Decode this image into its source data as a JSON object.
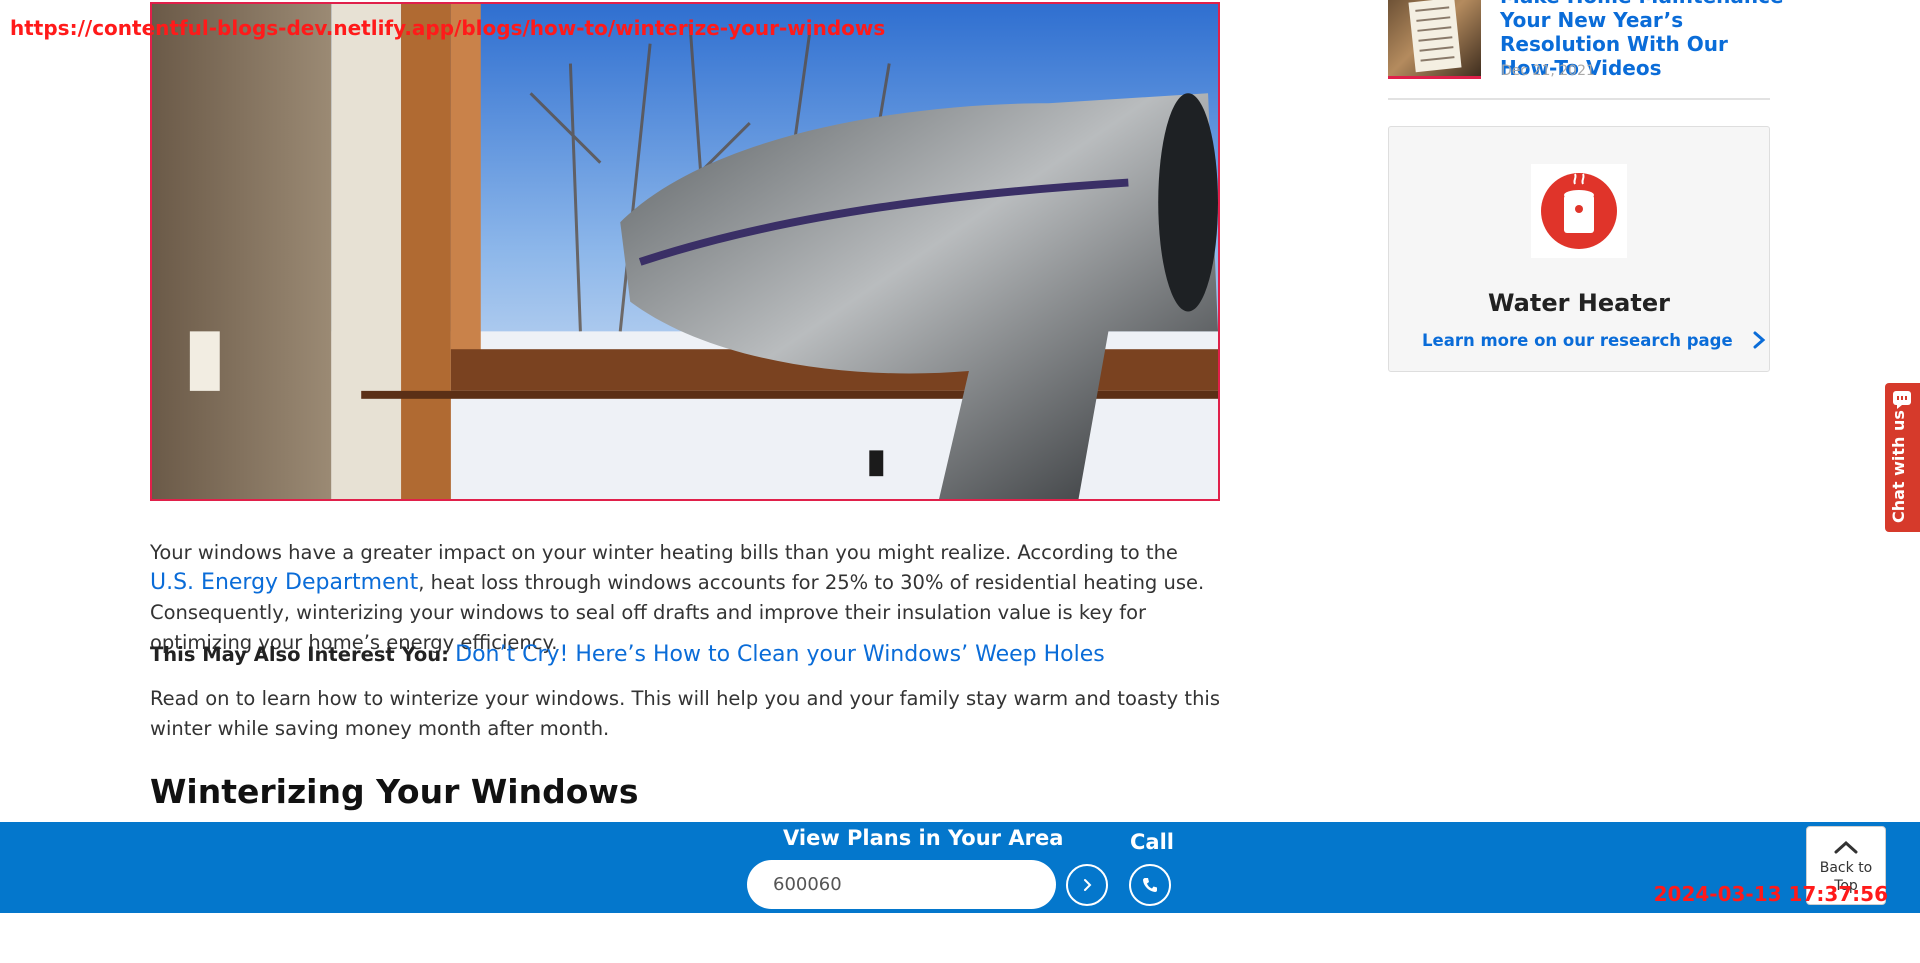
{
  "page_url": "https://contentful-blogs-dev.netlify.app/blogs/how-to/winterize-your-windows",
  "timestamp": "2024-03-13 17:37:56",
  "article": {
    "p1_before": "Your windows have a greater impact on your winter heating bills than you might realize. According to the ",
    "p1_link": "U.S. Energy Department",
    "p1_after": ", heat loss through windows accounts for 25% to 30% of residential heating use. Consequently, winterizing your windows to seal off drafts and improve their insulation value is key for optimizing your home’s energy efficiency.",
    "interest_label": "This May Also Interest You:",
    "interest_link": "Don’t Cry! Here’s How to Clean your Windows’ Weep Holes",
    "p3": "Read on to learn how to winterize your windows. This will help you and your family stay warm and toasty this winter while saving money month after month.",
    "section_heading": "Winterizing Your Windows"
  },
  "sidebar": {
    "related": {
      "title": "Make Home Maintenance Your New Year’s Resolution With Our How-To Videos",
      "date": "Dec 21, 2021"
    },
    "research_card": {
      "title": "Water Heater",
      "link": "Learn more on our research page",
      "icon": "water-heater-icon",
      "icon_color": "#e0342a"
    }
  },
  "chat": {
    "label": "Chat with us",
    "color": "#d63a2b"
  },
  "bottom_bar": {
    "plans_label": "View Plans in Your Area",
    "zip_value": "600060",
    "call_label": "Call",
    "back_to_top": "Back to Top",
    "bar_color": "#0477cc"
  }
}
